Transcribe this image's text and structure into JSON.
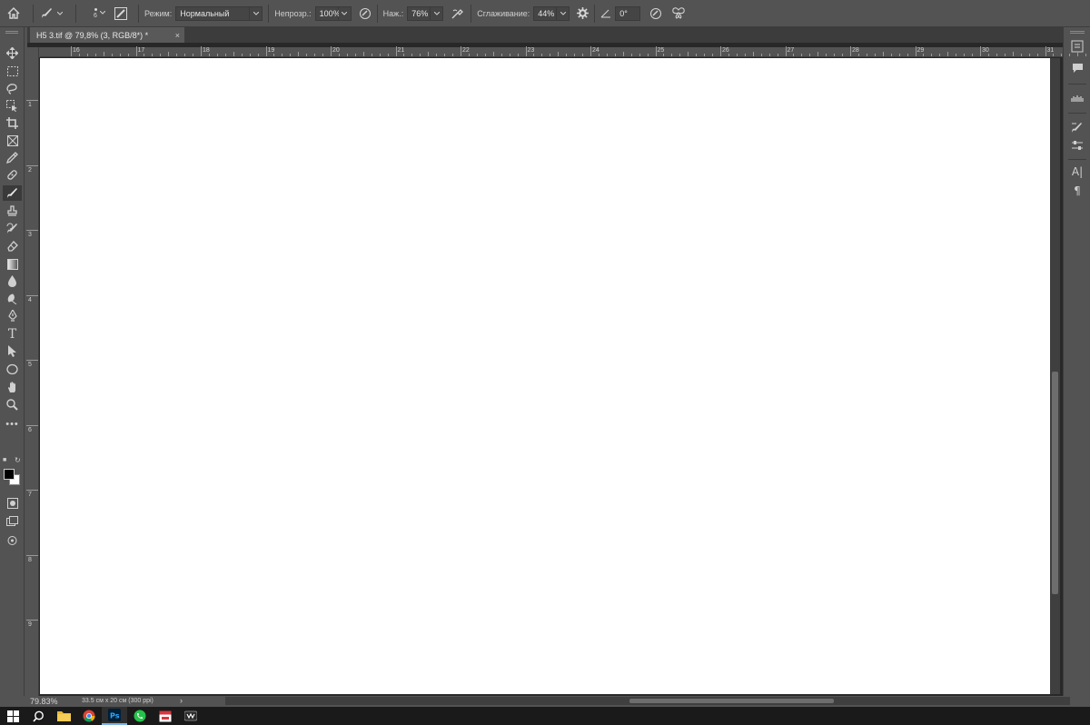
{
  "options_bar": {
    "home_icon": "home-icon",
    "brush_size": "6",
    "mode_label": "Режим:",
    "mode_value": "Нормальный",
    "opacity_label": "Непрозр.:",
    "opacity_value": "100%",
    "pressure_label": "Наж.:",
    "pressure_value": "76%",
    "smoothing_label": "Сглаживание:",
    "smoothing_value": "44%",
    "angle_value": "0°"
  },
  "document_tab": {
    "title": "H5 3.tif @ 79,8% (3, RGB/8*) *",
    "close": "×"
  },
  "ruler": {
    "top_labels": [
      "16",
      "17",
      "18",
      "19",
      "20",
      "21",
      "22",
      "23",
      "24",
      "25",
      "26",
      "27",
      "28",
      "29",
      "30",
      "31"
    ],
    "left_labels": [
      "1",
      "2",
      "3",
      "4",
      "5",
      "6",
      "7",
      "8",
      "9"
    ]
  },
  "status_bar": {
    "zoom": "79.83%",
    "doc_info": "33.5 см х 20 см (300 ppi)",
    "arrow": "›"
  },
  "colors": {
    "panel": "#535353",
    "canvas": "#ffffff",
    "foreground": "#000000",
    "background": "#ffffff"
  }
}
